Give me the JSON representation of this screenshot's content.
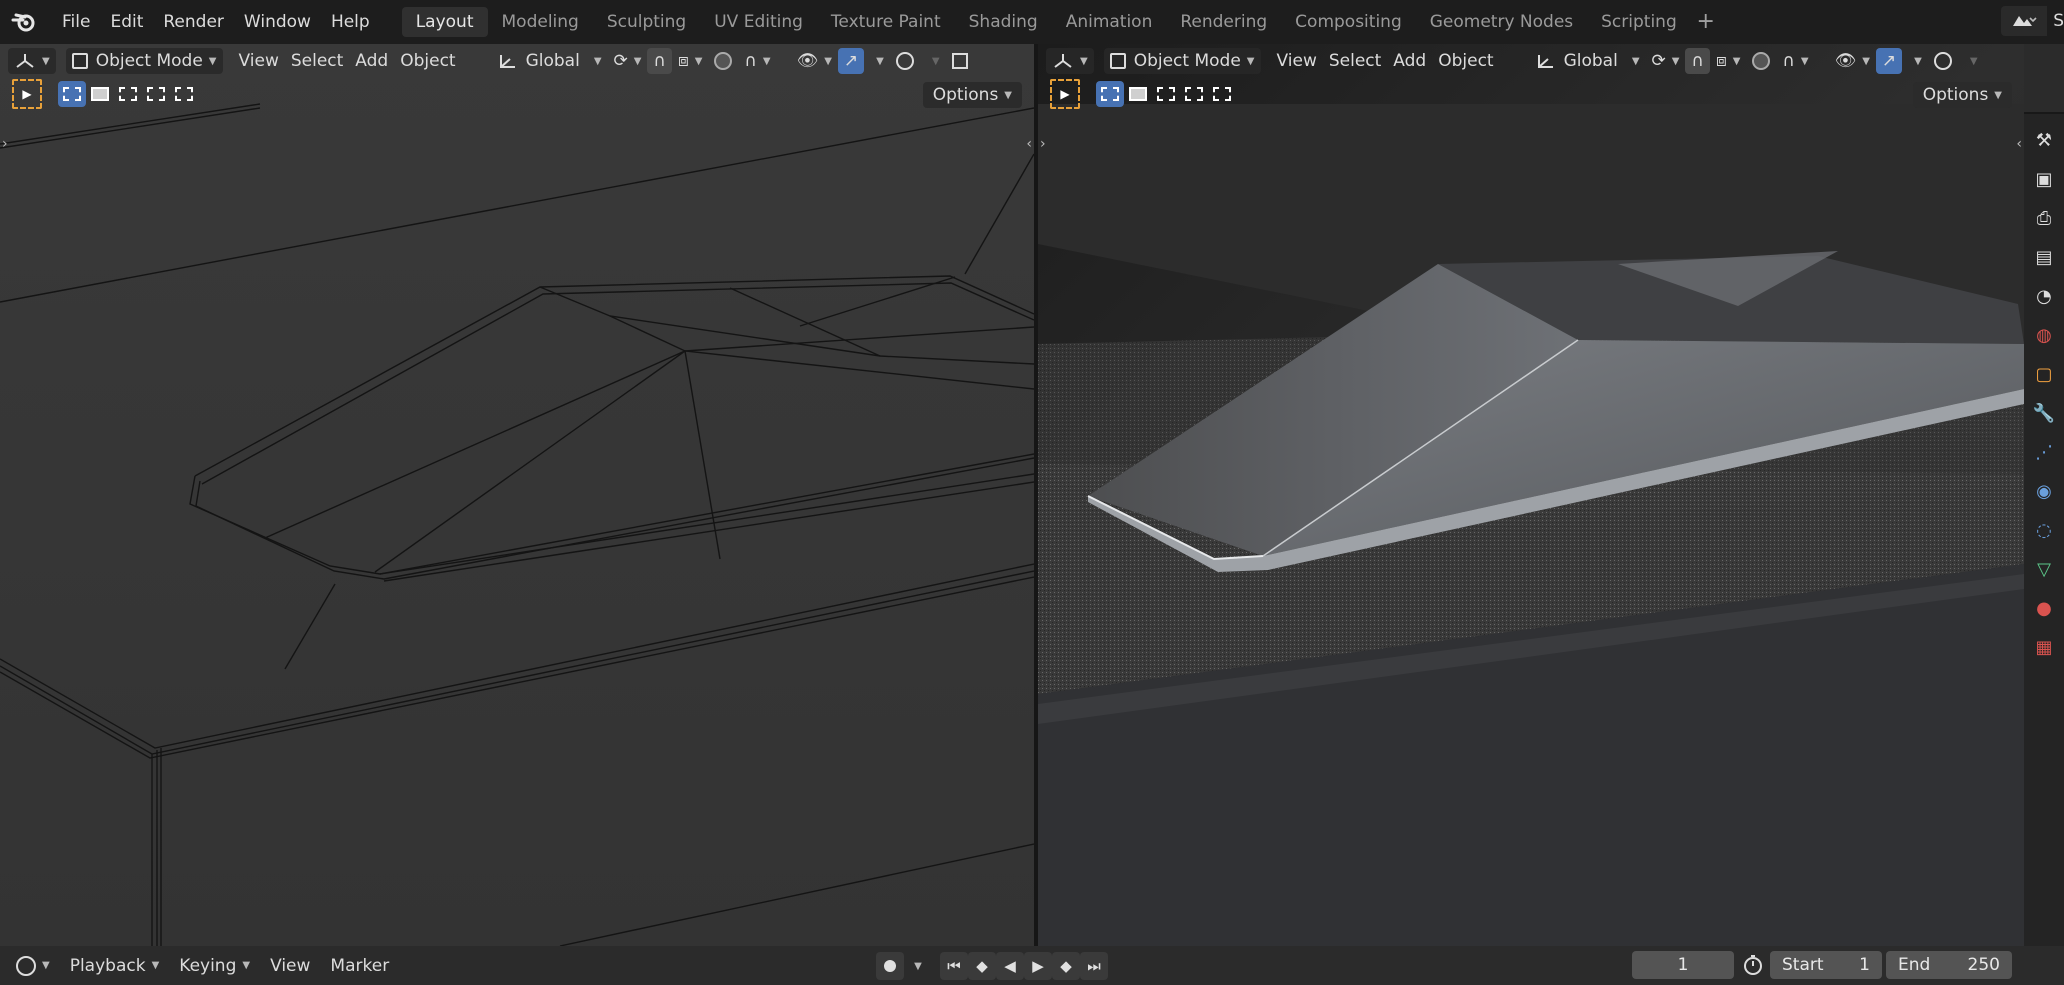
{
  "menus": [
    "File",
    "Edit",
    "Render",
    "Window",
    "Help"
  ],
  "workspaces": [
    "Layout",
    "Modeling",
    "Sculpting",
    "UV Editing",
    "Texture Paint",
    "Shading",
    "Animation",
    "Rendering",
    "Compositing",
    "Geometry Nodes",
    "Scripting"
  ],
  "active_workspace": "Layout",
  "scene_label": "S",
  "viewport_left": {
    "mode": "Object Mode",
    "menu": [
      "View",
      "Select",
      "Add",
      "Object"
    ],
    "transform_orientation": "Global",
    "options_label": "Options",
    "shading": "wireframe"
  },
  "viewport_right": {
    "mode": "Object Mode",
    "menu": [
      "View",
      "Select",
      "Add",
      "Object"
    ],
    "transform_orientation": "Global",
    "options_label": "Options",
    "shading": "rendered"
  },
  "timeline": {
    "playback_label": "Playback",
    "keying_label": "Keying",
    "view_label": "View",
    "marker_label": "Marker",
    "current_frame": "1",
    "start_label": "Start",
    "start_value": "1",
    "end_label": "End",
    "end_value": "250"
  },
  "colors": {
    "accent_blue": "#4772b3",
    "active_tool_outline": "#e8a13a",
    "topbar_bg": "#1d1d1d",
    "viewport_bg": "#3b3b3b",
    "header_bg": "#2b2b2b"
  },
  "property_tabs": [
    "tool-icon",
    "render-icon",
    "output-icon",
    "view-layer-icon",
    "scene-icon",
    "world-icon",
    "object-icon",
    "modifier-icon",
    "particles-icon",
    "physics-icon",
    "constraints-icon",
    "data-icon",
    "material-icon",
    "texture-icon"
  ]
}
